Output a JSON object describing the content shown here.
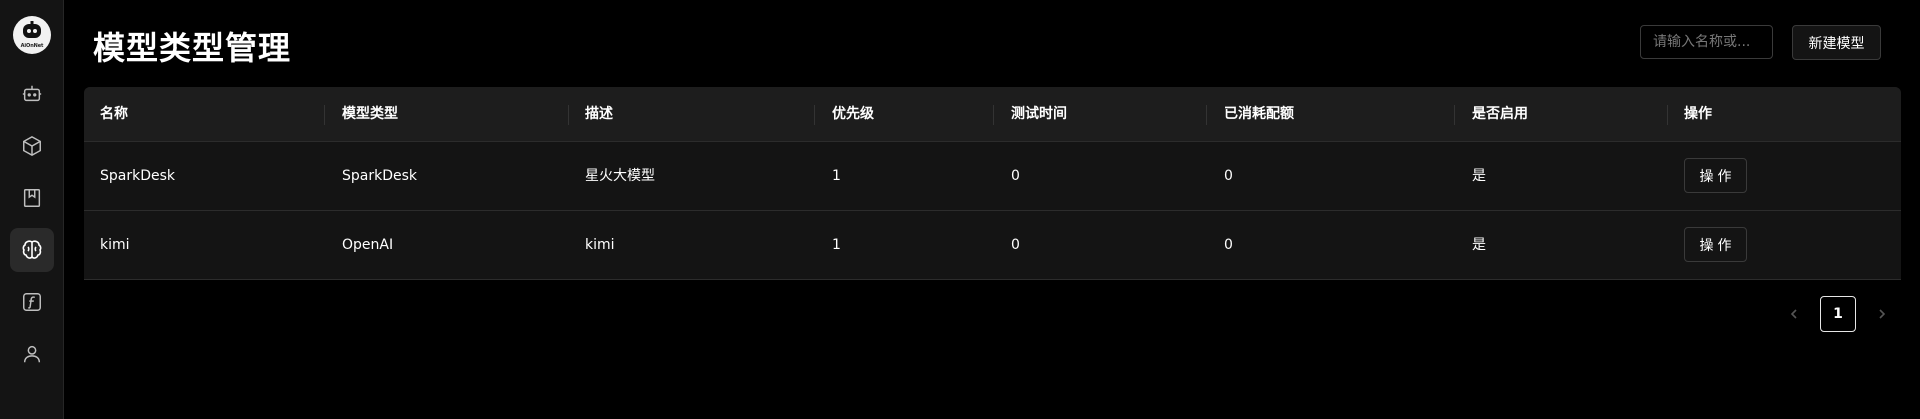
{
  "app": {
    "logo_text": "AiOnNet"
  },
  "sidebar": {
    "items": [
      {
        "icon": "robot-icon"
      },
      {
        "icon": "cube-icon"
      },
      {
        "icon": "bookmark-icon"
      },
      {
        "icon": "brain-icon",
        "active": true
      },
      {
        "icon": "function-icon"
      },
      {
        "icon": "user-icon"
      }
    ]
  },
  "header": {
    "title": "模型类型管理",
    "search_placeholder": "请输入名称或...",
    "new_button": "新建模型"
  },
  "table": {
    "columns": [
      "名称",
      "模型类型",
      "描述",
      "优先级",
      "测试时间",
      "已消耗配额",
      "是否启用",
      "操作"
    ],
    "rows": [
      {
        "name": "SparkDesk",
        "type": "SparkDesk",
        "desc": "星火大模型",
        "priority": "1",
        "test_time": "0",
        "quota_used": "0",
        "enabled": "是",
        "action": "操作"
      },
      {
        "name": "kimi",
        "type": "OpenAI",
        "desc": "kimi",
        "priority": "1",
        "test_time": "0",
        "quota_used": "0",
        "enabled": "是",
        "action": "操作"
      }
    ]
  },
  "pagination": {
    "current_page": "1"
  }
}
